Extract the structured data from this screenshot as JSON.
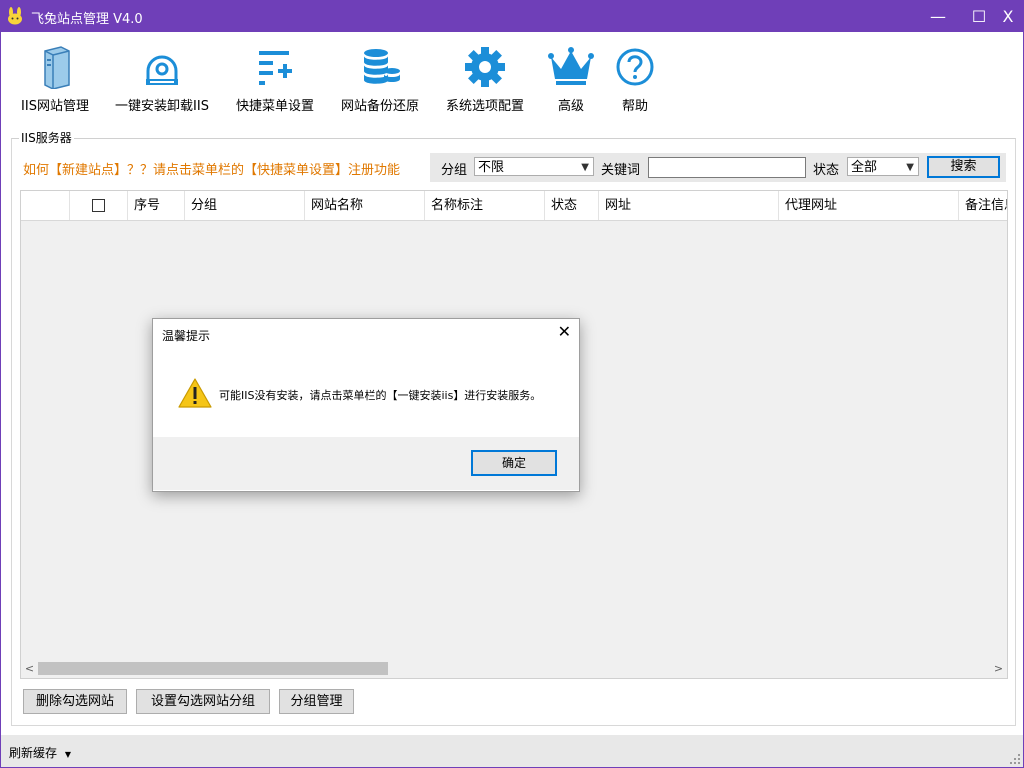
{
  "window": {
    "title": "飞兔站点管理  V4.0",
    "minimize_glyph": "—",
    "maximize_glyph": "☐",
    "close_glyph": "X"
  },
  "toolbar": {
    "items": [
      {
        "label": "IIS网站管理",
        "icon": "server-icon"
      },
      {
        "label": "一键安装卸载IIS",
        "icon": "disk-install-icon"
      },
      {
        "label": "快捷菜单设置",
        "icon": "menu-add-icon"
      },
      {
        "label": "网站备份还原",
        "icon": "database-icon"
      },
      {
        "label": "系统选项配置",
        "icon": "gear-icon"
      },
      {
        "label": "高级",
        "icon": "crown-icon"
      },
      {
        "label": "帮助",
        "icon": "help-icon"
      }
    ]
  },
  "panel": {
    "group_title": "IIS服务器",
    "hint": "如何【新建站点】？？请点击菜单栏的【快捷菜单设置】注册功能"
  },
  "filter": {
    "group_label": "分组",
    "group_value": "不限",
    "keyword_label": "关键词",
    "keyword_value": "",
    "status_label": "状态",
    "status_value": "全部",
    "search_label": "搜索"
  },
  "grid": {
    "columns": [
      "",
      "",
      "序号",
      "分组",
      "网站名称",
      "名称标注",
      "状态",
      "网址",
      "代理网址",
      "备注信息"
    ],
    "rows": []
  },
  "buttons": {
    "delete_checked": "删除勾选网站",
    "set_group": "设置勾选网站分组",
    "group_manage": "分组管理"
  },
  "status": {
    "refresh_cache": "刷新缓存"
  },
  "dialog": {
    "title": "温馨提示",
    "close_glyph": "✕",
    "message": "可能IIS没有安装，请点击菜单栏的【一键安装iis】进行安装服务。",
    "ok_label": "确定"
  },
  "colors": {
    "titlebar": "#6f3fb8",
    "icon_blue": "#1c8ed8",
    "hint_orange": "#e07800",
    "warning_yellow": "#f5c518"
  }
}
